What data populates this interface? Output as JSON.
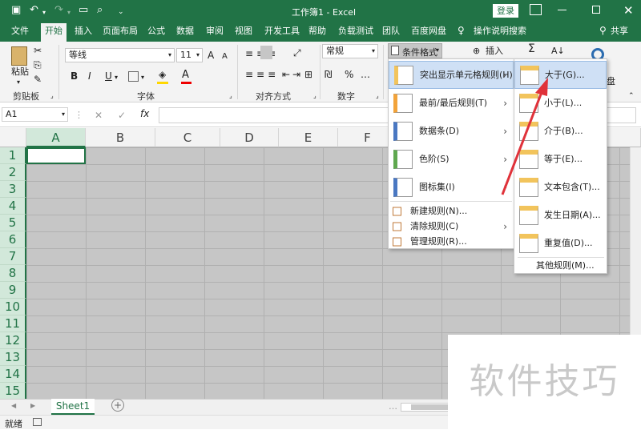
{
  "titlebar": {
    "title": "工作簿1 - Excel",
    "login": "登录",
    "qa_icons": [
      "save-icon",
      "undo-icon",
      "redo-icon",
      "open-folder-icon",
      "print-preview-icon",
      "customize-icon"
    ]
  },
  "tabs": [
    "文件",
    "开始",
    "插入",
    "页面布局",
    "公式",
    "数据",
    "审阅",
    "视图",
    "开发工具",
    "帮助",
    "负载测试",
    "团队",
    "百度网盘"
  ],
  "tell_me": "操作说明搜索",
  "share": "共享",
  "ribbon": {
    "paste": "粘贴",
    "clipboard": "剪贴板",
    "font_name": "等线",
    "font_size": "11",
    "bold": "B",
    "italic": "I",
    "underline": "U",
    "font_group": "字体",
    "align_group": "对齐方式",
    "number_format": "常规",
    "number_group": "数字",
    "conditional": "条件格式",
    "insert": "插入",
    "sum": "Σ",
    "pan": "盘",
    "font_grow": "A",
    "font_shrink": "A",
    "percent": "%",
    "dots": "…",
    "arrow": "▾"
  },
  "formula": {
    "namebox": "A1",
    "fx": "fx",
    "cancel": "✕",
    "enter": "✓"
  },
  "columns": [
    "A",
    "B",
    "C",
    "D",
    "E",
    "F"
  ],
  "rows": [
    "1",
    "2",
    "3",
    "4",
    "5",
    "6",
    "7",
    "8",
    "9",
    "10",
    "11",
    "12",
    "13",
    "14",
    "15"
  ],
  "sheet": {
    "tab": "Sheet1",
    "add": "+",
    "prev": "◀",
    "next": "▶",
    "more": "…"
  },
  "status": {
    "ready": "就绪"
  },
  "menu_main": [
    {
      "label": "突出显示单元格规则(H)",
      "icon": "highlight-cells-icon",
      "arrow": "›"
    },
    {
      "label": "最前/最后规则(T)",
      "icon": "top-bottom-icon",
      "arrow": "›"
    },
    {
      "label": "数据条(D)",
      "icon": "data-bars-icon",
      "arrow": "›"
    },
    {
      "label": "色阶(S)",
      "icon": "color-scales-icon",
      "arrow": "›"
    },
    {
      "label": "图标集(I)",
      "icon": "icon-sets-icon",
      "arrow": "›"
    }
  ],
  "menu_main_small": [
    {
      "label": "新建规则(N)...",
      "arrow": ""
    },
    {
      "label": "清除规则(C)",
      "arrow": "›"
    },
    {
      "label": "管理规则(R)...",
      "arrow": ""
    }
  ],
  "menu_sub": [
    {
      "label": "大于(G)...",
      "icon": "greater-than-icon"
    },
    {
      "label": "小于(L)...",
      "icon": "less-than-icon"
    },
    {
      "label": "介于(B)...",
      "icon": "between-icon"
    },
    {
      "label": "等于(E)...",
      "icon": "equal-to-icon"
    },
    {
      "label": "文本包含(T)...",
      "icon": "text-contains-icon"
    },
    {
      "label": "发生日期(A)...",
      "icon": "date-occurring-icon"
    },
    {
      "label": "重复值(D)...",
      "icon": "duplicate-values-icon"
    }
  ],
  "menu_sub_more": "其他规则(M)...",
  "watermark": "软件技巧",
  "colors": {
    "excel_green": "#217346",
    "selection_green": "#d2e8da",
    "cell_gray": "#c6c6c6",
    "menu_highlight": "#cfe0f5",
    "arrow_red": "#e0323a"
  }
}
